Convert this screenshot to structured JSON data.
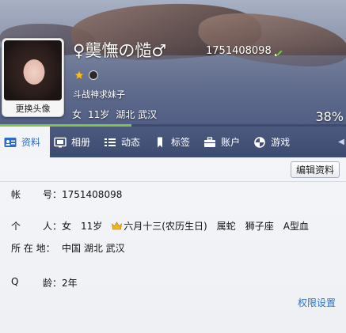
{
  "profile": {
    "nickname": "♀龑憮の慥♂",
    "qq_number": "1751408098",
    "signature": "斗战神求妹子",
    "brief": [
      "女",
      "11岁",
      "湖北 武汉"
    ],
    "avatar_label": "更换头像",
    "completeness_percent": "38%",
    "completeness_value": 0.38
  },
  "tabs": [
    {
      "label": "资料",
      "icon": "profile-card-icon",
      "active": true
    },
    {
      "label": "相册",
      "icon": "photo-album-icon",
      "active": false
    },
    {
      "label": "动态",
      "icon": "feed-list-icon",
      "active": false
    },
    {
      "label": "标签",
      "icon": "bookmark-tag-icon",
      "active": false
    },
    {
      "label": "账户",
      "icon": "briefcase-account-icon",
      "active": false
    },
    {
      "label": "游戏",
      "icon": "game-icon",
      "active": false
    }
  ],
  "content": {
    "edit_button": "编辑资料",
    "account": {
      "label": [
        "帐",
        "号："
      ],
      "value": "1751408098"
    },
    "personal": {
      "label": [
        "个",
        "人："
      ],
      "gender": "女",
      "age": "11岁",
      "birthday": "六月十三(农历生日)",
      "zodiac": "属蛇",
      "constellation": "狮子座",
      "blood": "A型血"
    },
    "location": {
      "label": "所 在 地：",
      "value": "中国 湖北 武汉"
    },
    "q_age": {
      "label": [
        "Q",
        "龄："
      ],
      "value": "2年"
    },
    "permission_link": "权限设置"
  },
  "colors": {
    "accent_link": "#2a74c9",
    "tab_bar": "#3e4b70",
    "progress": "#7fc34a"
  }
}
